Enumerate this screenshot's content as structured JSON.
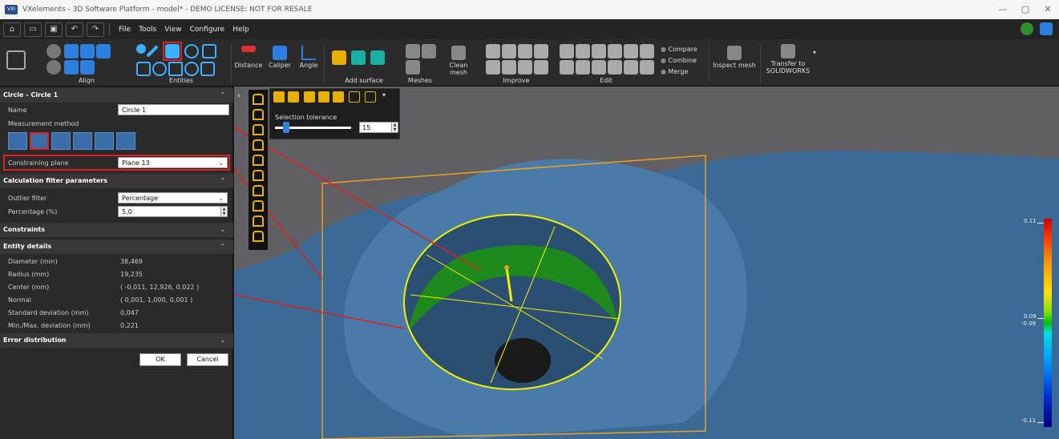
{
  "window": {
    "title": "VXelements - 3D Software Platform - model* - DEMO LICENSE: NOT FOR RESALE",
    "logo_text": "VXl",
    "minimize": "—",
    "maximize": "▢",
    "close": "✕"
  },
  "menu": {
    "file": "File",
    "tools": "Tools",
    "view": "View",
    "configure": "Configure",
    "help": "Help"
  },
  "ribbon": {
    "groups": {
      "align": "Align",
      "entities": "Entities",
      "add_surface": "Add surface",
      "meshes": "Meshes",
      "improve": "Improve",
      "edit": "Edit"
    },
    "buttons": {
      "distance": "Distance",
      "caliper": "Caliper",
      "angle": "Angle",
      "clean_mesh": "Clean mesh",
      "compare": "Compare",
      "combine": "Combine",
      "merge": "Merge",
      "inspect_mesh": "Inspect mesh",
      "transfer_to": "Transfer to",
      "solidworks": "SOLIDWORKS"
    }
  },
  "panel": {
    "header": "Circle - Circle 1",
    "name_label": "Name",
    "name_value": "Circle 1",
    "measurement_method_label": "Measurement method",
    "constraining_plane_label": "Constraining plane",
    "constraining_plane_value": "Plane 13",
    "calc_filter_header": "Calculation filter parameters",
    "outlier_filter_label": "Outlier filter",
    "outlier_filter_value": "Percentage",
    "percentage_label": "Percentage (%)",
    "percentage_value": "5,0",
    "constraints_header": "Constraints",
    "entity_details_header": "Entity details",
    "details": [
      {
        "label": "Diameter (mm)",
        "value": "38,469"
      },
      {
        "label": "Radius (mm)",
        "value": "19,235"
      },
      {
        "label": "Center (mm)",
        "value": "( -0,011, 12,926, 0,022 )"
      },
      {
        "label": "Normal",
        "value": "( 0,001, 1,000, 0,001 )"
      },
      {
        "label": "Standard deviation (mm)",
        "value": "0,047"
      },
      {
        "label": "Min./Max. deviation (mm)",
        "value": "0,221"
      }
    ],
    "error_distribution_header": "Error distribution",
    "ok": "OK",
    "cancel": "Cancel",
    "chevron_up": "⌃",
    "chevron_down": "⌄"
  },
  "viewport": {
    "selection_tolerance_label": "Selection tolerance",
    "selection_tolerance_value": "15",
    "selection_tolerance_fraction": 0.15,
    "colorbar": {
      "max": "0.11",
      "upper_mid": "0.09",
      "lower_mid": "-0.09",
      "min": "-0.11"
    }
  },
  "colors": {
    "mesh_blue": "#3c6a96",
    "highlight_red": "#e02020",
    "circle_yellow": "#f0f000",
    "plane_orange": "#f0a020",
    "inlier_green": "#1e8a1e"
  }
}
